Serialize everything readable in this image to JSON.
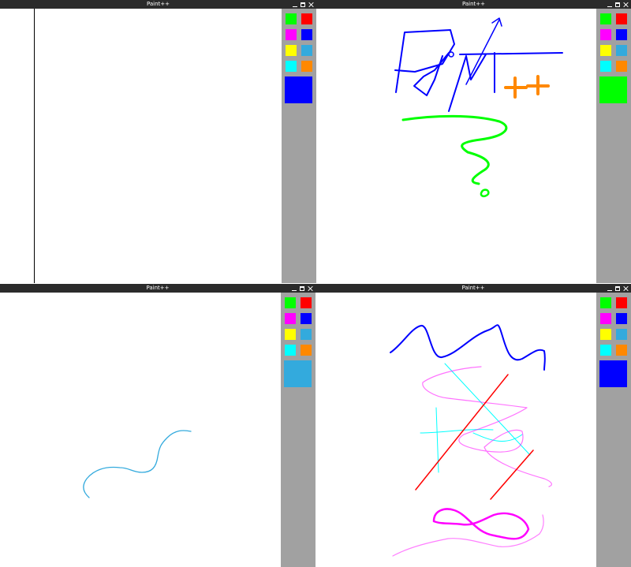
{
  "app": {
    "title": "Paint++"
  },
  "colors": {
    "green": "#00ff00",
    "red": "#ff0000",
    "magenta": "#ff00ff",
    "blue": "#0000ff",
    "yellow": "#ffff00",
    "light_blue": "#33aadd",
    "cyan": "#00ffff",
    "orange": "#ff8800"
  },
  "palette": [
    {
      "name": "green",
      "color": "#00ff00"
    },
    {
      "name": "red",
      "color": "#ff0000"
    },
    {
      "name": "magenta",
      "color": "#ff00ff"
    },
    {
      "name": "blue",
      "color": "#0000ff"
    },
    {
      "name": "yellow",
      "color": "#ffff00"
    },
    {
      "name": "light-blue",
      "color": "#33aadd"
    },
    {
      "name": "cyan",
      "color": "#00ffff"
    },
    {
      "name": "orange",
      "color": "#ff8800"
    }
  ],
  "windows": [
    {
      "title": "Paint++",
      "current_color": "#0000ff"
    },
    {
      "title": "Paint++",
      "current_color": "#00ff00"
    },
    {
      "title": "Paint++",
      "current_color": "#33aadd"
    },
    {
      "title": "Paint++",
      "current_color": "#0000ff"
    }
  ]
}
